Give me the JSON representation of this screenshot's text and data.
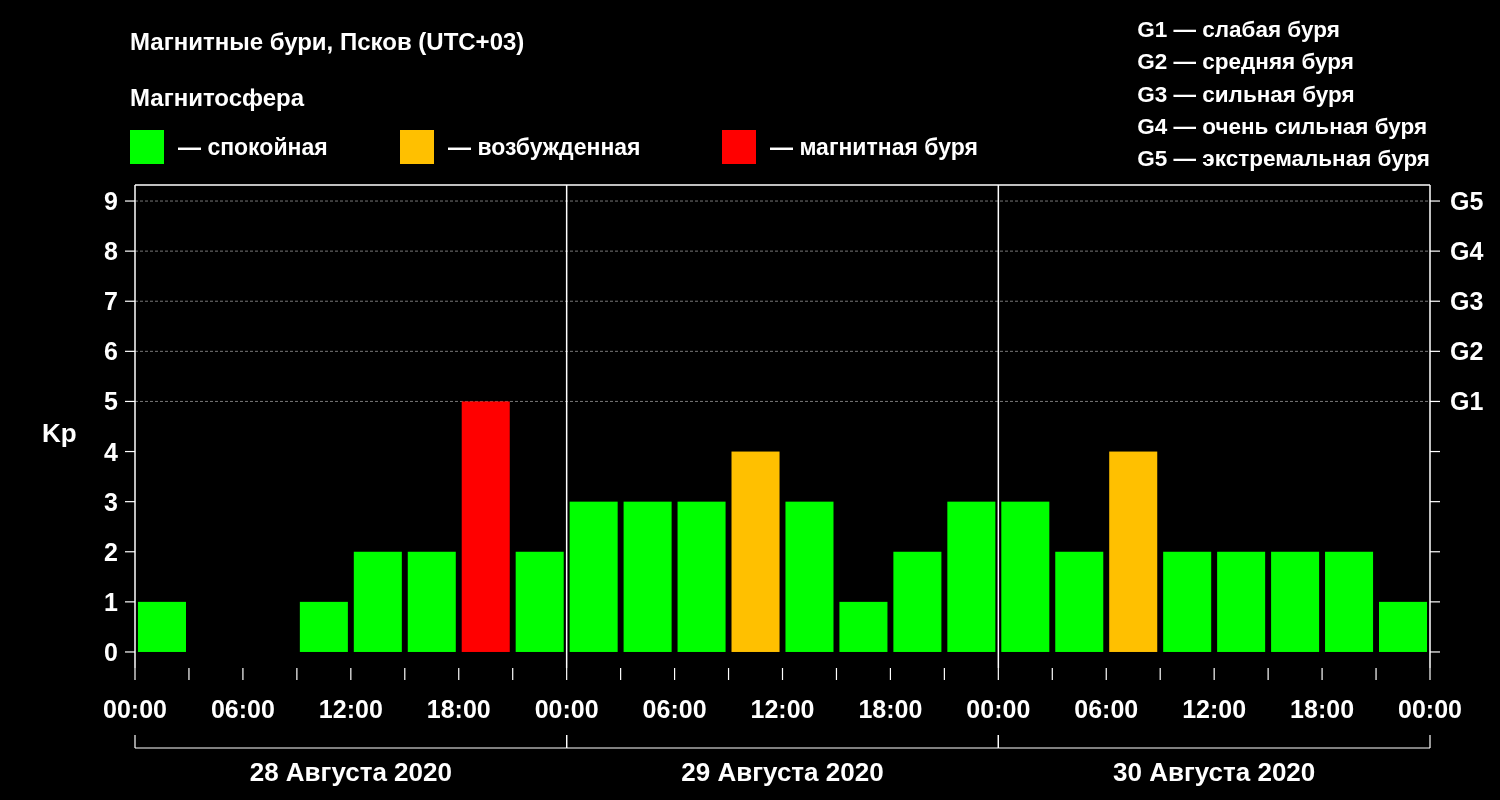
{
  "title": "Магнитные бури, Псков (UTC+03)",
  "legend": {
    "title": "Магнитосфера",
    "items": [
      {
        "marker": "—",
        "color": "#00ff00"
      },
      {
        "marker": "—",
        "color": "#ffc000"
      },
      {
        "marker": "—",
        "color": "#ff0000"
      }
    ]
  },
  "g_scale": [
    "G1 — слабая буря",
    "G2 — средняя буря",
    "G3 — сильная буря",
    "G4 — очень сильная буря",
    "G5 — экстремальная буря"
  ],
  "chart_data": {
    "type": "bar",
    "ylabel": "Kp",
    "stacked": true,
    "grid": true,
    "categories": [
      null,
      null,
      null,
      null,
      null,
      null,
      null,
      null,
      null,
      null,
      null,
      null,
      null,
      null,
      null,
      null,
      null,
      null,
      null,
      null,
      null,
      null,
      null,
      null
    ],
    "series": [
      {
        "name": "спокойная",
        "color": "#00ff00",
        "values": [
          1,
          0,
          0,
          1,
          2,
          2,
          null,
          2,
          3,
          3,
          3,
          null,
          3,
          1,
          2,
          3,
          3,
          2,
          null,
          2,
          2,
          2,
          2,
          1
        ]
      },
      {
        "name": "возбужденная",
        "color": "#ffc000",
        "values": [
          null,
          null,
          null,
          null,
          null,
          null,
          null,
          null,
          null,
          null,
          null,
          4,
          null,
          null,
          null,
          null,
          null,
          null,
          4,
          null,
          null,
          null,
          null,
          null
        ]
      },
      {
        "name": "магнитная буря",
        "color": "#ff0000",
        "values": [
          null,
          null,
          null,
          null,
          null,
          null,
          5,
          null,
          null,
          null,
          null,
          null,
          null,
          null,
          null,
          null,
          null,
          null,
          null,
          null,
          null,
          null,
          null,
          null
        ]
      }
    ],
    "ylim": [
      -0.32,
      9.32
    ],
    "yticks": [
      0,
      1,
      2,
      3,
      4,
      5,
      6,
      7,
      8,
      9
    ]
  },
  "time_labels": [
    "00:00",
    "06:00",
    "12:00",
    "18:00",
    "00:00",
    "06:00",
    "12:00",
    "18:00",
    "00:00",
    "06:00",
    "12:00",
    "18:00",
    "00:00"
  ],
  "storm_levels": [
    "G5",
    "G4",
    "G3",
    "G2",
    "G1"
  ],
  "days": [
    "28 Августа 2020",
    "29 Августа 2020",
    "30 Августа 2020"
  ]
}
